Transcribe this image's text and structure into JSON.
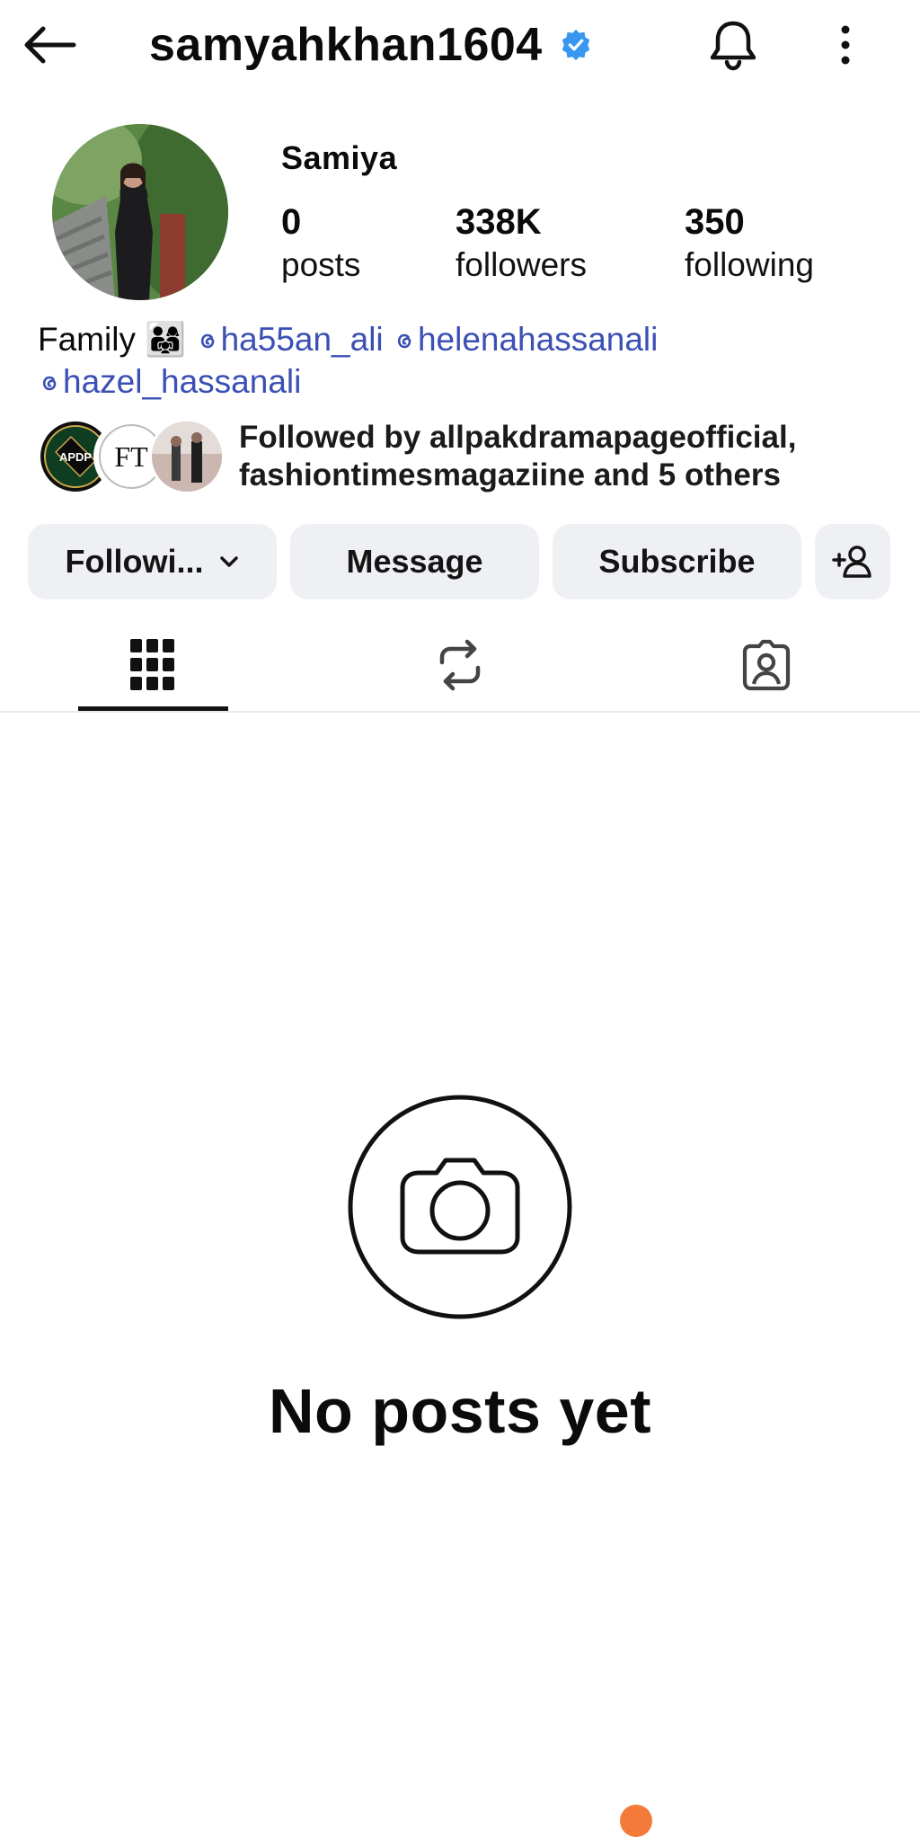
{
  "header": {
    "username": "samyahkhan1604",
    "back_icon": "arrow-left-icon",
    "verified_icon": "verified-badge-icon",
    "bell_icon": "bell-icon",
    "more_icon": "more-vertical-icon",
    "verified_color": "#3897f0"
  },
  "profile": {
    "display_name": "Samiya",
    "stats": {
      "posts_count": "0",
      "posts_label": "posts",
      "followers_count": "338K",
      "followers_label": "followers",
      "following_count": "350",
      "following_label": "following"
    },
    "bio": {
      "prefix": "Family",
      "emoji": "👨‍👩‍👧",
      "mentions": [
        "ha55an_ali",
        "helenahassanali",
        "hazel_hassanali"
      ]
    },
    "followed_by": {
      "line1": "Followed by allpakdramapageofficial,",
      "line2": "fashiontimesmagaziine and 5 others",
      "avatar1_text": "APDP",
      "avatar2_text": "FT"
    }
  },
  "actions": {
    "following_label": "Followi...",
    "message_label": "Message",
    "subscribe_label": "Subscribe",
    "add_user_icon": "add-user-icon"
  },
  "tabs": [
    {
      "name": "posts",
      "icon": "grid-icon",
      "active": true
    },
    {
      "name": "reels",
      "icon": "repost-icon",
      "active": false
    },
    {
      "name": "tagged",
      "icon": "tagged-user-icon",
      "active": false
    }
  ],
  "empty_state": {
    "icon": "camera-icon",
    "text": "No posts yet"
  },
  "colors": {
    "mention": "#3b4fb4",
    "button_bg": "#eef0f4"
  }
}
